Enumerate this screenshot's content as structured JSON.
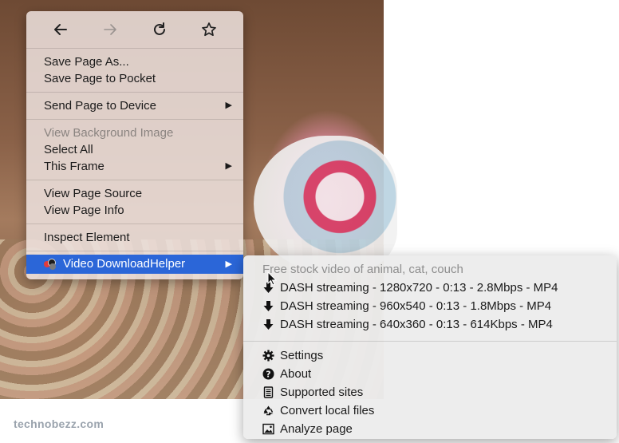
{
  "nav": {
    "back_icon": "back-arrow-icon",
    "forward_icon": "forward-arrow-icon",
    "reload_icon": "reload-icon",
    "bookmark_icon": "star-icon"
  },
  "menu": {
    "save_page_as": "Save Page As...",
    "save_to_pocket": "Save Page to Pocket",
    "send_to_device": "Send Page to Device",
    "view_bg_image": "View Background Image",
    "select_all": "Select All",
    "this_frame": "This Frame",
    "view_source": "View Page Source",
    "view_info": "View Page Info",
    "inspect": "Inspect Element",
    "video_downloadhelper": "Video DownloadHelper",
    "arrow": "▶"
  },
  "submenu": {
    "caption": "Free stock video of animal, cat, couch",
    "streams": [
      "DASH streaming - 1280x720 - 0:13 - 2.8Mbps - MP4",
      "DASH streaming - 960x540 - 0:13 - 1.8Mbps - MP4",
      "DASH streaming - 640x360 - 0:13 - 614Kbps - MP4"
    ],
    "settings": "Settings",
    "about": "About",
    "supported_sites": "Supported sites",
    "convert_local": "Convert local files",
    "analyze_page": "Analyze page"
  },
  "watermark": "technobezz.com",
  "colors": {
    "selected_bg": "#2b66d8",
    "disabled_text": "#8a8480"
  }
}
